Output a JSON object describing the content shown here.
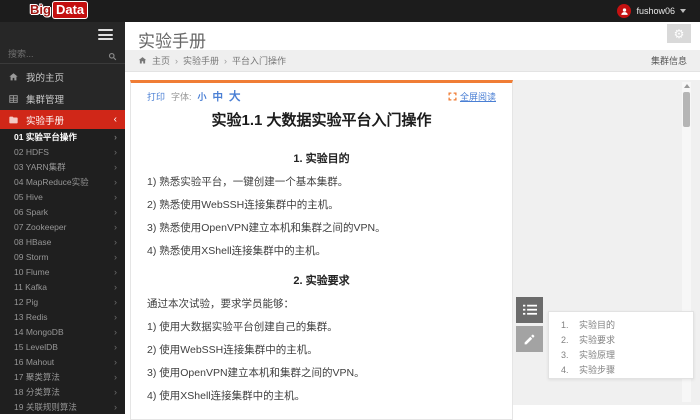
{
  "topbar": {
    "logo_big": "Big",
    "logo_data": "Data",
    "username": "fushow06"
  },
  "sidebar": {
    "search_placeholder": "搜索...",
    "menu": [
      {
        "label": "我的主页"
      },
      {
        "label": "集群管理"
      },
      {
        "label": "实验手册"
      }
    ],
    "submenu": [
      "01 实验平台操作",
      "02 HDFS",
      "03 YARN集群",
      "04 MapReduce实验",
      "05 Hive",
      "06 Spark",
      "07 Zookeeper",
      "08 HBase",
      "09 Storm",
      "10 Flume",
      "11 Kafka",
      "12 Pig",
      "13 Redis",
      "14 MongoDB",
      "15 LevelDB",
      "16 Mahout",
      "17 聚类算法",
      "18 分类算法",
      "19 关联规则算法"
    ]
  },
  "header": {
    "title": "实验手册",
    "breadcrumb": [
      "主页",
      "实验手册",
      "平台入门操作"
    ],
    "separator": "›",
    "cluster_info": "集群信息"
  },
  "doc": {
    "toolbar": {
      "print": "打印",
      "font_label": "字体:",
      "size_small": "小",
      "size_medium": "中",
      "size_large": "大",
      "fullscreen": "全屏阅读"
    },
    "title": "实验1.1 大数据实验平台入门操作",
    "sections": [
      {
        "heading": "1. 实验目的",
        "paras": [
          "1) 熟悉实验平台，一键创建一个基本集群。",
          "2) 熟悉使用WebSSH连接集群中的主机。",
          "3) 熟悉使用OpenVPN建立本机和集群之间的VPN。",
          "4) 熟悉使用XShell连接集群中的主机。"
        ]
      },
      {
        "heading": "2. 实验要求",
        "paras": [
          "通过本次试验，要求学员能够：",
          "1) 使用大数据实验平台创建自己的集群。",
          "2) 使用WebSSH连接集群中的主机。",
          "3) 使用OpenVPN建立本机和集群之间的VPN。",
          "4) 使用XShell连接集群中的主机。"
        ]
      }
    ]
  },
  "toc": {
    "items": [
      {
        "num": "1.",
        "label": "实验目的"
      },
      {
        "num": "2.",
        "label": "实验要求"
      },
      {
        "num": "3.",
        "label": "实验原理"
      },
      {
        "num": "4.",
        "label": "实验步骤"
      }
    ]
  },
  "icons": {
    "gear": "⚙",
    "chevron_left": "‹",
    "chevron_right": "›"
  },
  "colors": {
    "accent_red": "#d02718",
    "link_blue": "#4a7fd4",
    "orange": "#f07d35"
  }
}
